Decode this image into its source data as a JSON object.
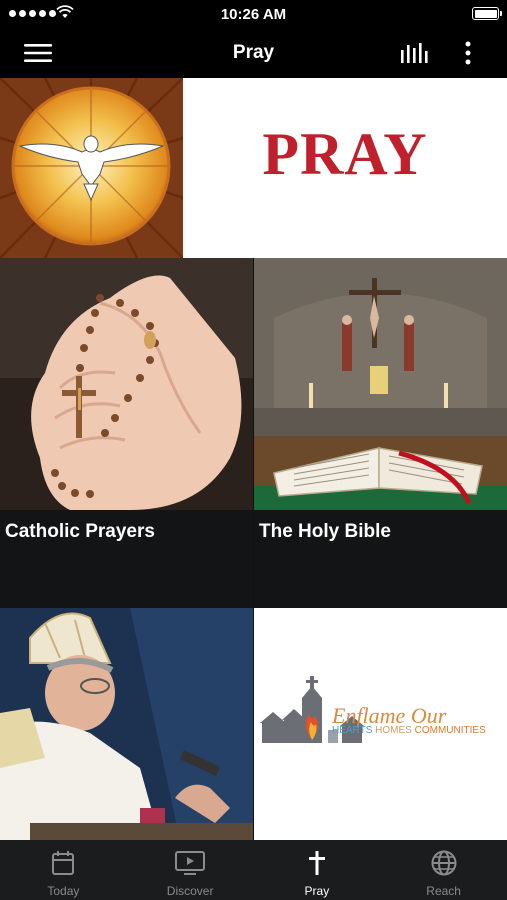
{
  "status_bar": {
    "time": "10:26 AM"
  },
  "header": {
    "title": "Pray"
  },
  "banner": {
    "wordmark": "Pray"
  },
  "tiles": [
    {
      "label": "Catholic Prayers"
    },
    {
      "label": "The Holy Bible"
    }
  ],
  "enflame": {
    "title": "Enflame Our",
    "subtitle_hearts": "HEARTS",
    "subtitle_homes": "HOMES",
    "subtitle_communities": "COMMUNITIES"
  },
  "tabbar": {
    "items": [
      {
        "label": "Today",
        "icon": "calendar-icon",
        "active": false
      },
      {
        "label": "Discover",
        "icon": "tv-icon",
        "active": false
      },
      {
        "label": "Pray",
        "icon": "cross-icon",
        "active": true
      },
      {
        "label": "Reach",
        "icon": "globe-icon",
        "active": false
      }
    ]
  },
  "colors": {
    "brand_red": "#c01f2c",
    "tabbar_bg": "#1b1c1e",
    "inactive_tab": "#8a8b8d"
  }
}
